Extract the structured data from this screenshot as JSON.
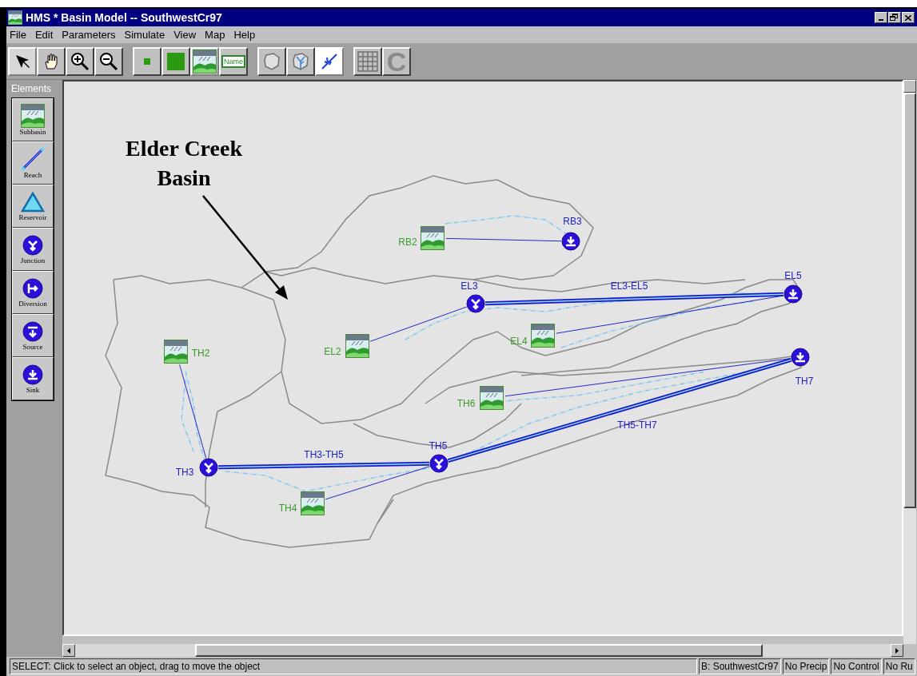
{
  "window": {
    "title": "HMS * Basin Model -- SouthwestCr97"
  },
  "menu": [
    "File",
    "Edit",
    "Parameters",
    "Simulate",
    "View",
    "Map",
    "Help"
  ],
  "toolbar": [
    {
      "kind": "arrow",
      "selected": true
    },
    {
      "kind": "hand",
      "selected": false
    },
    {
      "kind": "zoom-in",
      "selected": false
    },
    {
      "kind": "zoom-out",
      "selected": false
    },
    {
      "kind": "gap"
    },
    {
      "kind": "small-square",
      "selected": false
    },
    {
      "kind": "large-square",
      "selected": false
    },
    {
      "kind": "subbasin",
      "selected": true
    },
    {
      "kind": "name",
      "label": "Name",
      "selected": false
    },
    {
      "kind": "gap"
    },
    {
      "kind": "outline",
      "selected": false
    },
    {
      "kind": "stream-outline",
      "selected": false
    },
    {
      "kind": "stream",
      "selected": true
    },
    {
      "kind": "gap"
    },
    {
      "kind": "grid",
      "selected": false
    },
    {
      "kind": "letter",
      "label": "C",
      "selected": false
    }
  ],
  "palette": {
    "title": "Elements",
    "items": [
      {
        "kind": "subbasin",
        "label": "Subbasin"
      },
      {
        "kind": "reach",
        "label": "Reach"
      },
      {
        "kind": "reservoir",
        "label": "Reservoir"
      },
      {
        "kind": "junction",
        "label": "Junction"
      },
      {
        "kind": "diversion",
        "label": "Diversion"
      },
      {
        "kind": "source",
        "label": "Source"
      },
      {
        "kind": "sink",
        "label": "Sink"
      }
    ]
  },
  "map": {
    "annotation": [
      "Elder Creek",
      "Basin"
    ],
    "elements": [
      {
        "kind": "subbasin",
        "label": "RB2"
      },
      {
        "kind": "sink",
        "label": "RB3"
      },
      {
        "kind": "junction",
        "label": "EL3"
      },
      {
        "kind": "sink",
        "label": "EL5"
      },
      {
        "kind": "subbasin",
        "label": "EL4"
      },
      {
        "kind": "subbasin",
        "label": "EL2"
      },
      {
        "kind": "subbasin",
        "label": "TH2"
      },
      {
        "kind": "sink",
        "label": "TH7"
      },
      {
        "kind": "subbasin",
        "label": "TH6"
      },
      {
        "kind": "junction",
        "label": "TH3"
      },
      {
        "kind": "junction",
        "label": "TH5"
      },
      {
        "kind": "subbasin",
        "label": "TH4"
      }
    ],
    "reaches": [
      {
        "label": "EL3-EL5"
      },
      {
        "label": "TH3-TH5"
      },
      {
        "label": "TH5-TH7"
      }
    ]
  },
  "status_bar": {
    "message": "SELECT: Click to select an object, drag to move the object",
    "panels": [
      "B: SouthwestCr97",
      "No Precip",
      "No Control",
      "No Ru"
    ]
  }
}
